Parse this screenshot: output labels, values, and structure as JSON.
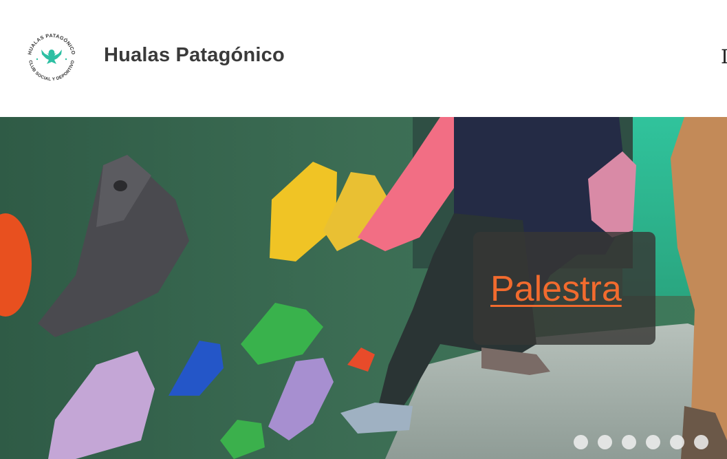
{
  "site": {
    "title": "Hualas Patagónico",
    "logo_ring_top": "HUALAS PATAGÓNICO",
    "logo_ring_bottom": "CLUB SOCIAL Y DEPORTIVO",
    "logo_icon": "bird-emblem-icon",
    "nav_partial_glyph": "I"
  },
  "hero": {
    "caption": "Palestra",
    "caption_color": "#f26b2e",
    "slide_count": 6,
    "dots": [
      "slide-1",
      "slide-2",
      "slide-3",
      "slide-4",
      "slide-5",
      "slide-6"
    ]
  },
  "colors": {
    "title": "#3a3a3a",
    "teal": "#2dbfa3",
    "wall_green": "#3b6b52"
  }
}
